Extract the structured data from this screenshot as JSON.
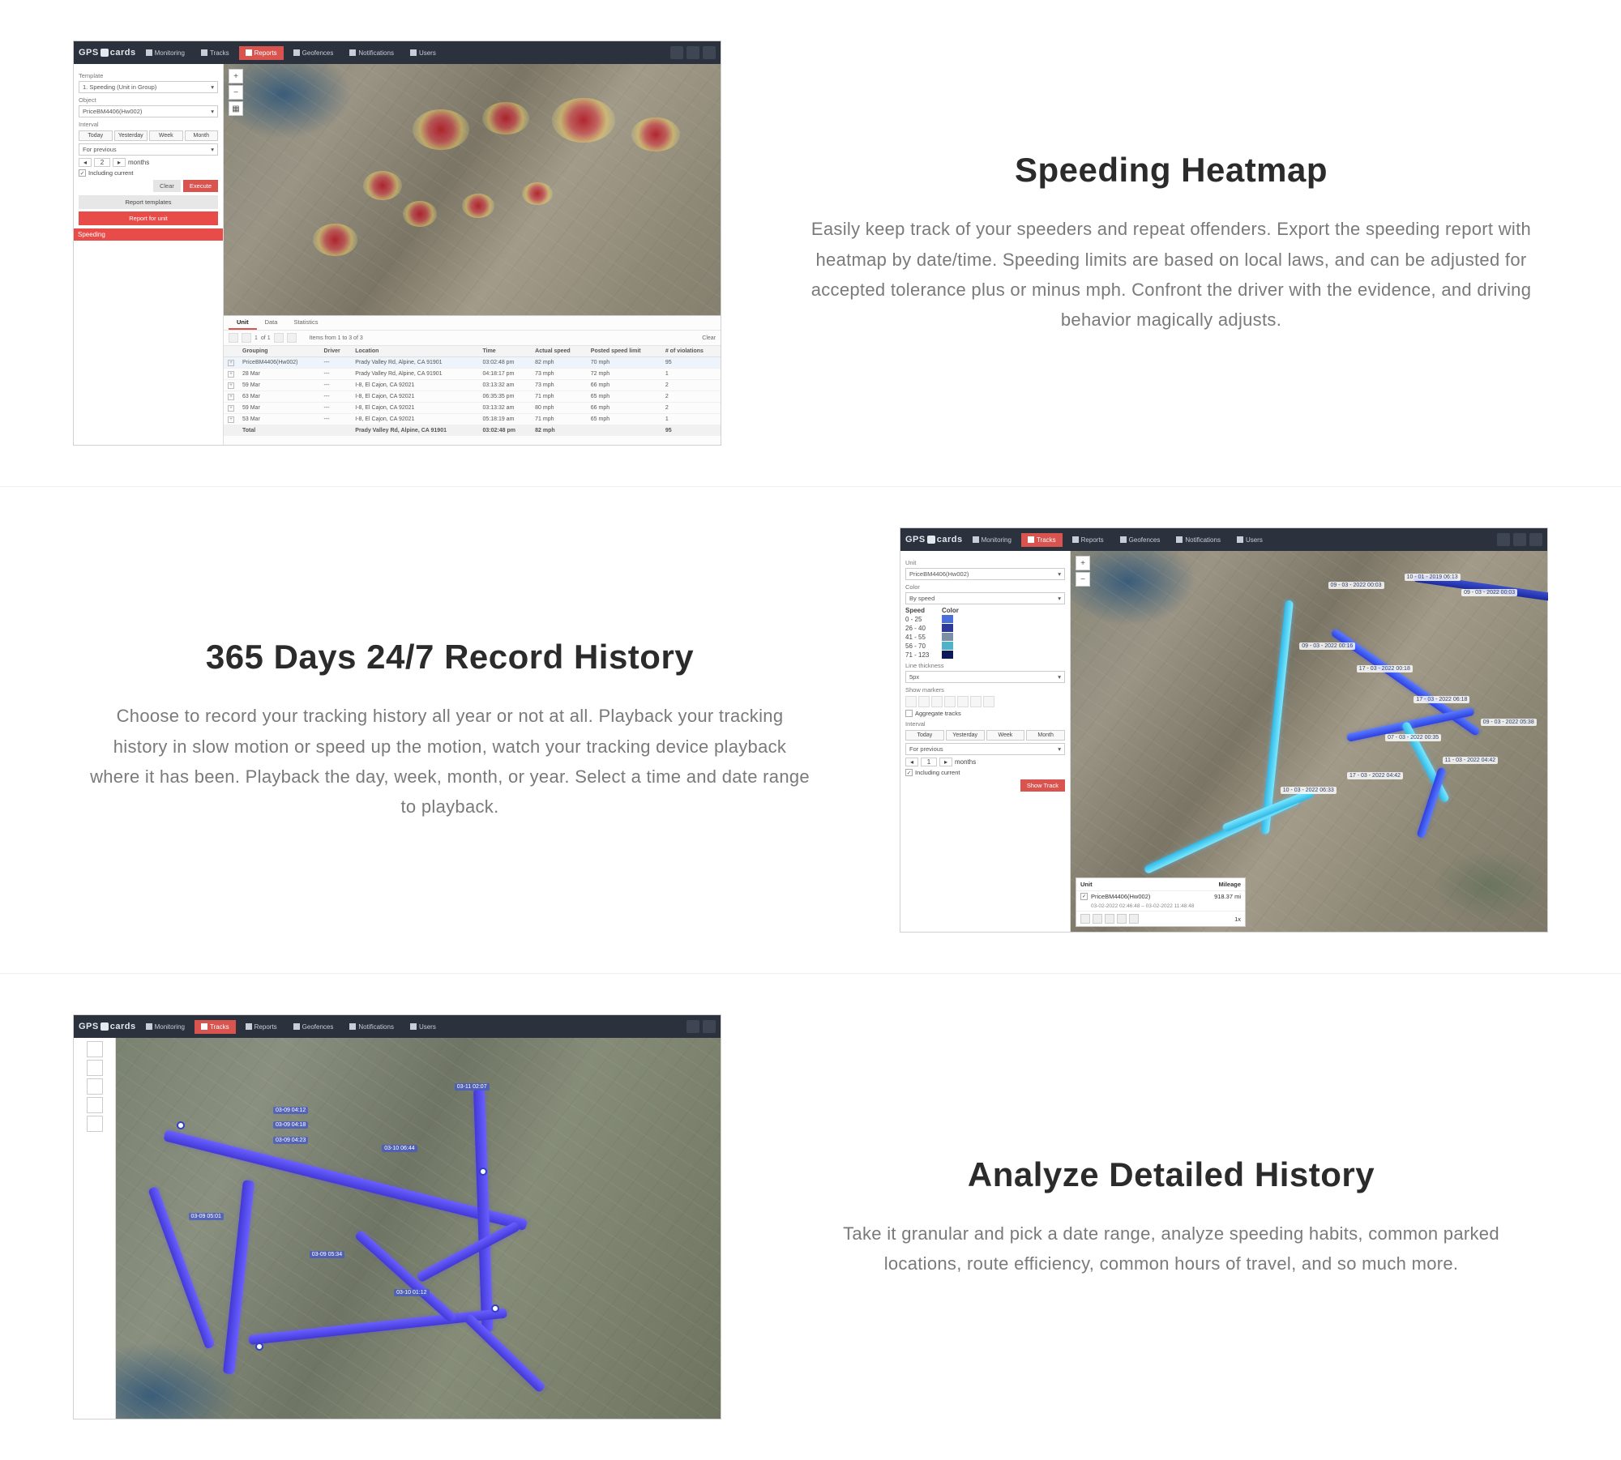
{
  "brand_prefix": "GPS",
  "brand_suffix": "cards",
  "topnav": {
    "monitoring": "Monitoring",
    "tracks": "Tracks",
    "reports": "Reports",
    "geofences": "Geofences",
    "notifications": "Notifications",
    "users": "Users"
  },
  "section1": {
    "title": "Speeding Heatmap",
    "body": "Easily keep track of your speeders and repeat offenders. Export the speeding report with heatmap by date/time. Speeding limits are based on local laws, and can be adjusted for accepted tolerance plus or minus mph. Confront the driver with the evidence, and driving behavior magically adjusts.",
    "sidebar": {
      "template_label": "Template",
      "template_value": "1. Speeding (Unit in Group)",
      "object_label": "Object",
      "object_value": "PriceBM4406(Hw002)",
      "interval_label": "Interval",
      "today": "Today",
      "yesterday": "Yesterday",
      "week": "Week",
      "month": "Month",
      "months_word": "months",
      "including_current": "Including current",
      "clear": "Clear",
      "execute": "Execute",
      "report_templates": "Report templates",
      "report_for_unit": "Report for unit",
      "speeding_header": "Speeding"
    },
    "tabletabs": {
      "unit": "Unit",
      "data": "Data",
      "statistics": "Statistics"
    },
    "paginator": {
      "page": "1",
      "of": "of 1",
      "items": "Items from 1 to 3 of 3",
      "clear": "Clear"
    },
    "columns": {
      "grouping": "Grouping",
      "driver": "Driver",
      "location": "Location",
      "time": "Time",
      "actual_speed": "Actual speed",
      "posted_limit": "Posted speed limit",
      "violations": "# of violations"
    },
    "rows": [
      {
        "grouping": "PriceBM4406(Hw002)",
        "driver": "---",
        "location": "Prady Valley Rd, Alpine, CA 91901",
        "time": "03:02:48 pm",
        "actual": "82 mph",
        "posted": "70 mph",
        "viol": "95"
      },
      {
        "grouping": "28 Mar",
        "driver": "---",
        "location": "Prady Valley Rd, Alpine, CA 91901",
        "time": "04:18:17 pm",
        "actual": "73 mph",
        "posted": "72 mph",
        "viol": "1"
      },
      {
        "grouping": "59 Mar",
        "driver": "---",
        "location": "I-8, El Cajon, CA 92021",
        "time": "03:13:32 am",
        "actual": "73 mph",
        "posted": "66 mph",
        "viol": "2"
      },
      {
        "grouping": "63 Mar",
        "driver": "---",
        "location": "I-8, El Cajon, CA 92021",
        "time": "06:35:35 pm",
        "actual": "71 mph",
        "posted": "65 mph",
        "viol": "2"
      },
      {
        "grouping": "59 Mar",
        "driver": "---",
        "location": "I-8, El Cajon, CA 92021",
        "time": "03:13:32 am",
        "actual": "80 mph",
        "posted": "66 mph",
        "viol": "2"
      },
      {
        "grouping": "53 Mar",
        "driver": "---",
        "location": "I-8, El Cajon, CA 92021",
        "time": "05:18:19 am",
        "actual": "71 mph",
        "posted": "65 mph",
        "viol": "1"
      }
    ],
    "total_row": {
      "label": "Total",
      "location": "Prady Valley Rd, Alpine, CA 91901",
      "time": "03:02:48 pm",
      "actual": "82 mph",
      "viol": "95"
    }
  },
  "section2": {
    "title": "365 Days 24/7 Record History",
    "body": "Choose to record your tracking history all year or not at all. Playback your tracking history in slow motion or speed up the motion, watch your tracking device playback where it has been. Playback the day, week, month, or year. Select a time and date range to playback.",
    "sidebar": {
      "unit_label": "Unit",
      "unit_value": "PriceBM4406(Hw002)",
      "color_label": "Color",
      "color_value": "By speed",
      "speed_h": "Speed",
      "color_h": "Color",
      "legend": [
        {
          "range": "0 - 25",
          "color": "#4a6fd8"
        },
        {
          "range": "26 - 40",
          "color": "#2d3a9a"
        },
        {
          "range": "41 - 55",
          "color": "#7b8fa6"
        },
        {
          "range": "56 - 70",
          "color": "#4fb2c9"
        },
        {
          "range": "71 - 123",
          "color": "#0c1a5a"
        }
      ],
      "line_thickness_label": "Line thickness",
      "line_thickness_value": "5px",
      "show_markers_label": "Show markers",
      "aggregate_label": "Aggregate tracks",
      "interval_label": "Interval",
      "today": "Today",
      "yesterday": "Yesterday",
      "week": "Week",
      "month": "Month",
      "prev_interval": "For previous",
      "months_word": "months",
      "including_current": "Including current",
      "show_track": "Show Track"
    },
    "track_panel": {
      "unit_h": "Unit",
      "mileage_h": "Mileage",
      "unit": "PriceBM4406(Hw002)",
      "range": "03-02-2022 02:46:48 – 03-02-2022 11:48:48",
      "mileage": "918.37 mi",
      "speed": "1x"
    },
    "timestamps": [
      "09 - 03 - 2022 00:03",
      "10 - 01 - 2019 06:13",
      "09 - 03 - 2022 00:03",
      "09 - 03 - 2022 00:16",
      "17 - 03 - 2022 00:18",
      "17 - 03 - 2022 06:18",
      "07 - 03 - 2022 00:35",
      "17 - 03 - 2022 04:42",
      "10 - 03 - 2022 06:33",
      "11 - 03 - 2022 04:42",
      "09 - 03 - 2022 05:38"
    ]
  },
  "section3": {
    "title": "Analyze Detailed History",
    "body": "Take it granular and pick a date range, analyze speeding habits, common parked locations, route efficiency, common hours of travel, and so much more."
  }
}
